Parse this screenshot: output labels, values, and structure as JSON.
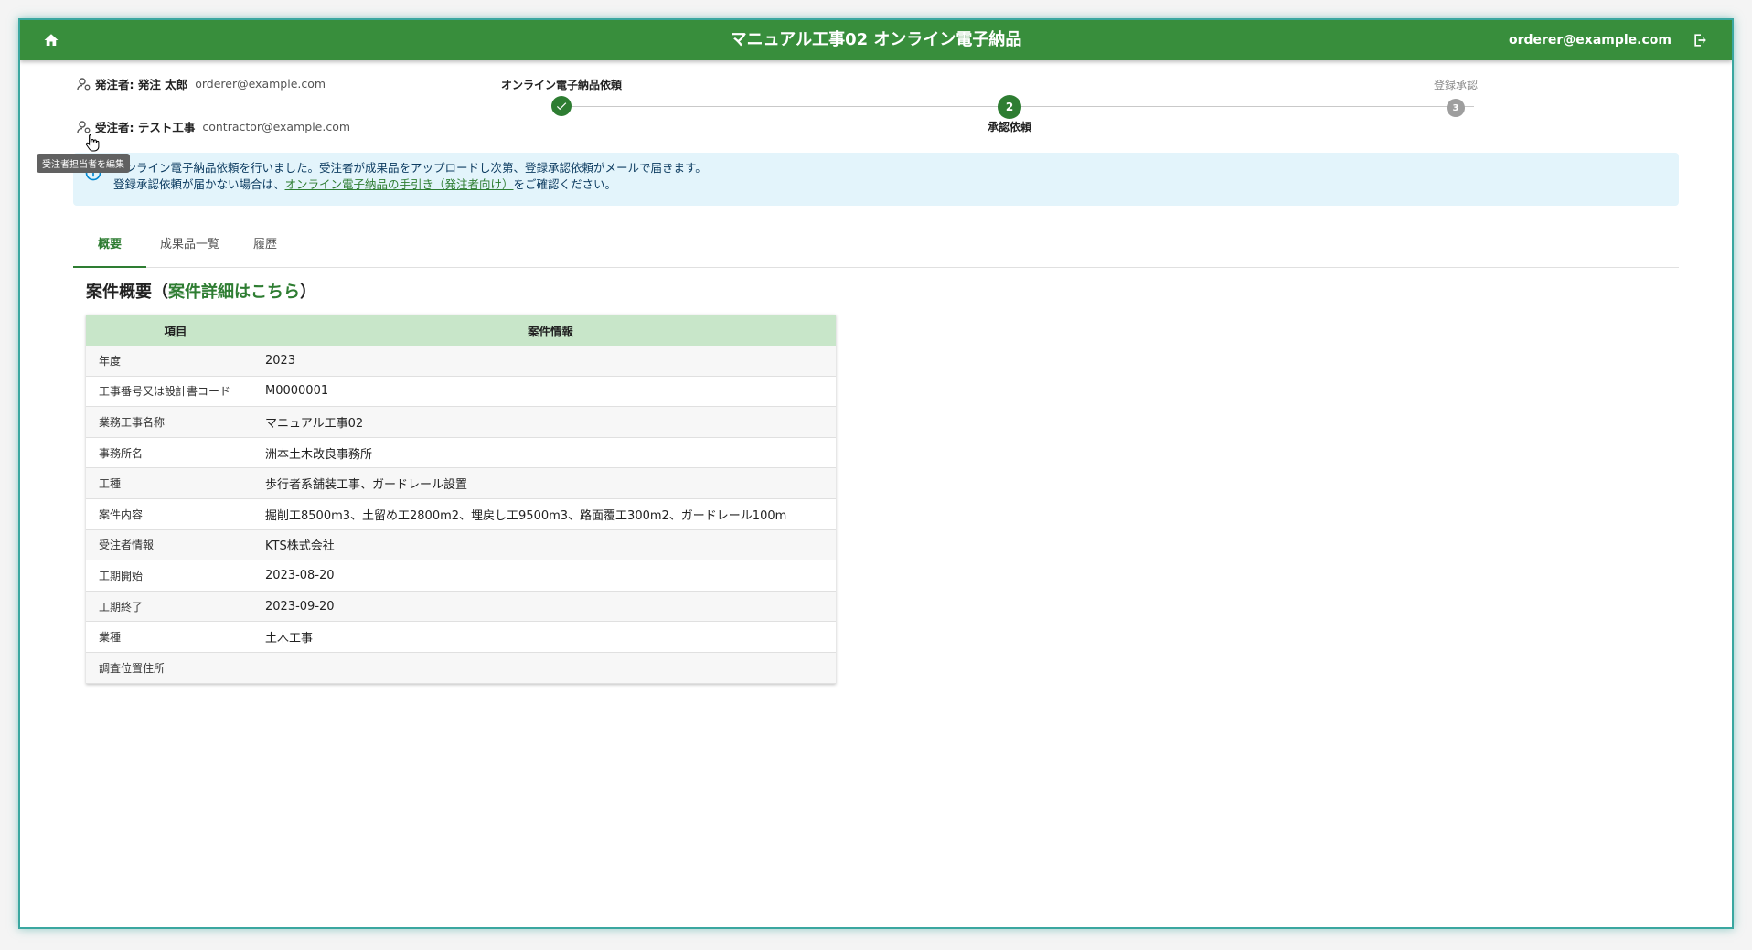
{
  "header": {
    "title": "マニュアル工事02 オンライン電子納品",
    "user_email": "orderer@example.com"
  },
  "parties": {
    "orderer": {
      "label": "発注者: 発注 太郎",
      "email": "orderer@example.com"
    },
    "contractor": {
      "label": "受注者: テスト工事",
      "email": "contractor@example.com"
    }
  },
  "tooltip": "受注者担当者を編集",
  "stepper": {
    "steps": [
      {
        "label": "オンライン電子納品依頼",
        "state": "done",
        "number": "1"
      },
      {
        "label": "承認依頼",
        "state": "active",
        "number": "2"
      },
      {
        "label": "登録承認",
        "state": "pending",
        "number": "3"
      }
    ],
    "colors": {
      "done": "#2e7d32",
      "active": "#2e7d32",
      "pending": "#9e9e9e"
    }
  },
  "alert": {
    "line1": "オンライン電子納品依頼を行いました。受注者が成果品をアップロードし次第、登録承認依頼がメールで届きます。",
    "line2_prefix": "登録承認依頼が届かない場合は、",
    "line2_link": "オンライン電子納品の手引き（発注者向け）",
    "line2_suffix": "をご確認ください。"
  },
  "tabs": [
    {
      "label": "概要",
      "active": true
    },
    {
      "label": "成果品一覧",
      "active": false
    },
    {
      "label": "履歴",
      "active": false
    }
  ],
  "summary": {
    "title_prefix": "案件概要（",
    "title_link": "案件詳細はこちら",
    "title_suffix": "）",
    "col_item": "項目",
    "col_info": "案件情報",
    "rows": [
      {
        "key": "年度",
        "value": "2023"
      },
      {
        "key": "工事番号又は設計書コード",
        "value": "M0000001"
      },
      {
        "key": "業務工事名称",
        "value": "マニュアル工事02"
      },
      {
        "key": "事務所名",
        "value": "洲本土木改良事務所"
      },
      {
        "key": "工種",
        "value": "歩行者系舗装工事、ガードレール設置"
      },
      {
        "key": "案件内容",
        "value": "掘削工8500m3、土留め工2800m2、埋戻し工9500m3、路面覆工300m2、ガードレール100m"
      },
      {
        "key": "受注者情報",
        "value": "KTS株式会社"
      },
      {
        "key": "工期開始",
        "value": "2023-08-20"
      },
      {
        "key": "工期終了",
        "value": "2023-09-20"
      },
      {
        "key": "業種",
        "value": "土木工事"
      },
      {
        "key": "調査位置住所",
        "value": ""
      }
    ]
  },
  "theme": {
    "primary": "#388e3c",
    "table_header": "#c8e6c9",
    "alert_bg": "#e3f4fb"
  }
}
